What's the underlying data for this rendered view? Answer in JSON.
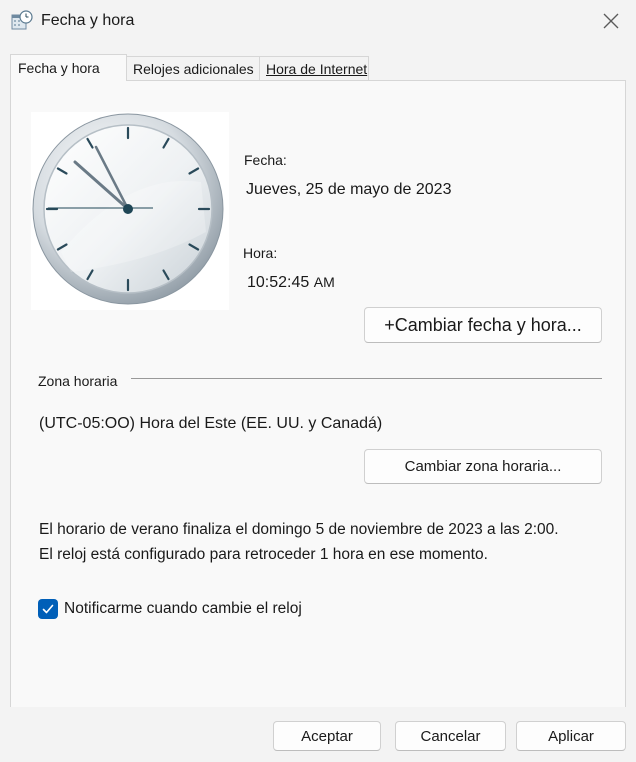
{
  "window": {
    "title": "Fecha y hora",
    "icon": "calendar-clock-icon"
  },
  "tabs": [
    {
      "label": "Fecha y hora",
      "active": true
    },
    {
      "label": "Relojes adicionales",
      "active": false
    },
    {
      "label": "Hora de Internet",
      "active": false
    }
  ],
  "datetime": {
    "date_label": "Fecha:",
    "date_value": "Jueves, 25 de mayo de 2023",
    "time_label": "Hora:",
    "time_value": "10:52:45",
    "time_ampm": "AM",
    "change_button": "+Cambiar fecha y hora..."
  },
  "timezone": {
    "section_label": "Zona horaria",
    "value": "(UTC-05:OO) Hora del Este (EE. UU. y Canadá)",
    "change_button": "Cambiar zona horaria..."
  },
  "dst": {
    "line1": "El horario de verano finaliza el domingo 5 de noviembre de 2023 a las 2:00.",
    "line2": "El reloj está configurado para retroceder 1 hora en ese momento."
  },
  "notify": {
    "label": "Notificarme cuando cambie el reloj",
    "checked": true
  },
  "footer": {
    "ok": "Aceptar",
    "cancel": "Cancelar",
    "apply": "Aplicar"
  },
  "colors": {
    "accent": "#005fb8",
    "background": "#f3f3f3",
    "panel": "#f9f9f9",
    "clock_hands": "#2a4a5a"
  }
}
